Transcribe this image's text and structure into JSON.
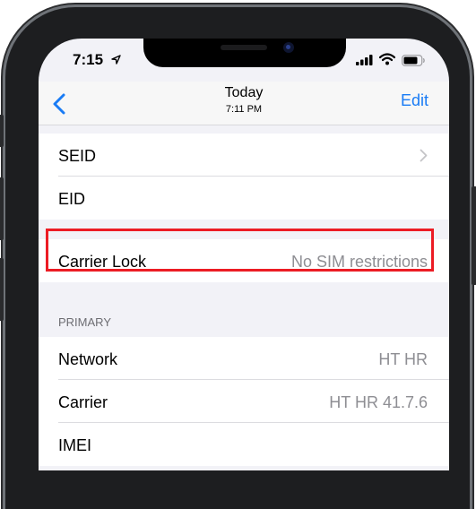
{
  "status_bar": {
    "time": "7:15"
  },
  "nav": {
    "title": "Today",
    "subtitle": "7:11 PM",
    "edit_label": "Edit"
  },
  "rows_top": [
    {
      "label": "SEID"
    },
    {
      "label": "EID"
    }
  ],
  "carrier_lock": {
    "label": "Carrier Lock",
    "value": "No SIM restrictions"
  },
  "section": {
    "header": "PRIMARY"
  },
  "rows_primary": [
    {
      "label": "Network",
      "value": "HT HR"
    },
    {
      "label": "Carrier",
      "value": "HT HR 41.7.6"
    },
    {
      "label": "IMEI",
      "value": ""
    }
  ],
  "colors": {
    "accent": "#1a7cf5",
    "highlight": "#ec1c24",
    "background": "#f2f2f7"
  }
}
